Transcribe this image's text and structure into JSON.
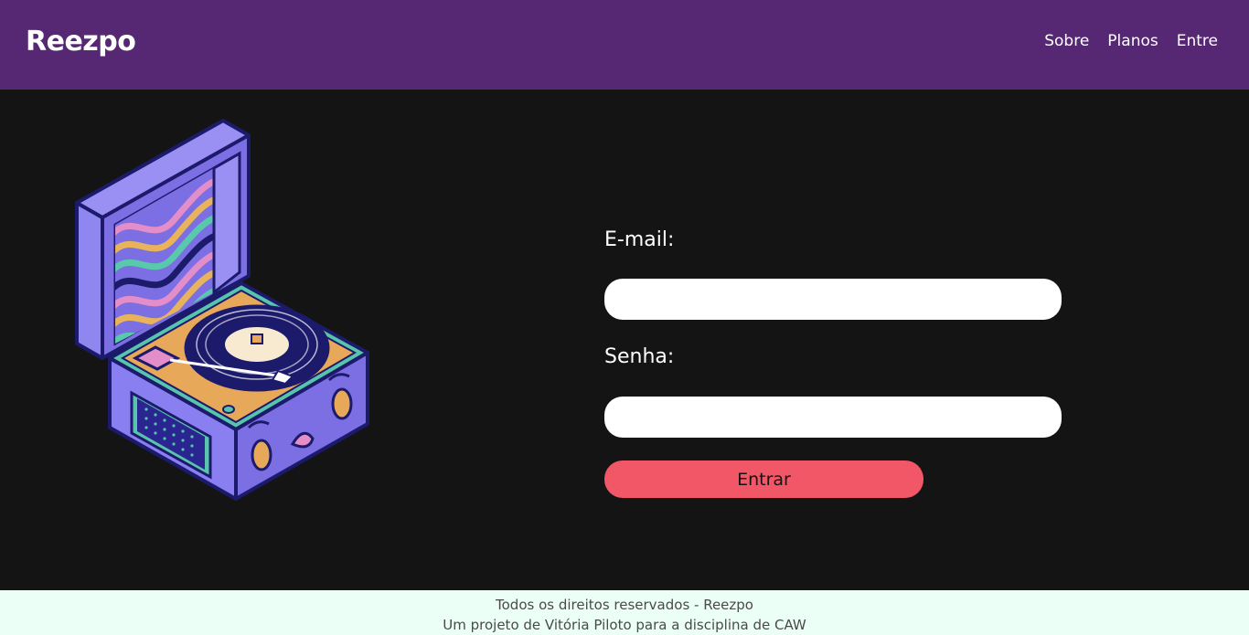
{
  "header": {
    "logo": "Reezpo",
    "nav": [
      "Sobre",
      "Planos",
      "Entre"
    ]
  },
  "form": {
    "email_label": "E-mail:",
    "email_value": "",
    "senha_label": "Senha:",
    "senha_value": "",
    "submit_label": "Entrar"
  },
  "footer": {
    "line1": "Todos os direitos reservados - Reezpo",
    "line2": "Um projeto de Vitória Piloto para a disciplina de CAW"
  },
  "colors": {
    "header_bg": "#562873",
    "page_bg": "#141414",
    "button": "#f25767",
    "footer_bg": "#ecfff6"
  },
  "icons": {
    "illustration": "record-player-illustration"
  }
}
